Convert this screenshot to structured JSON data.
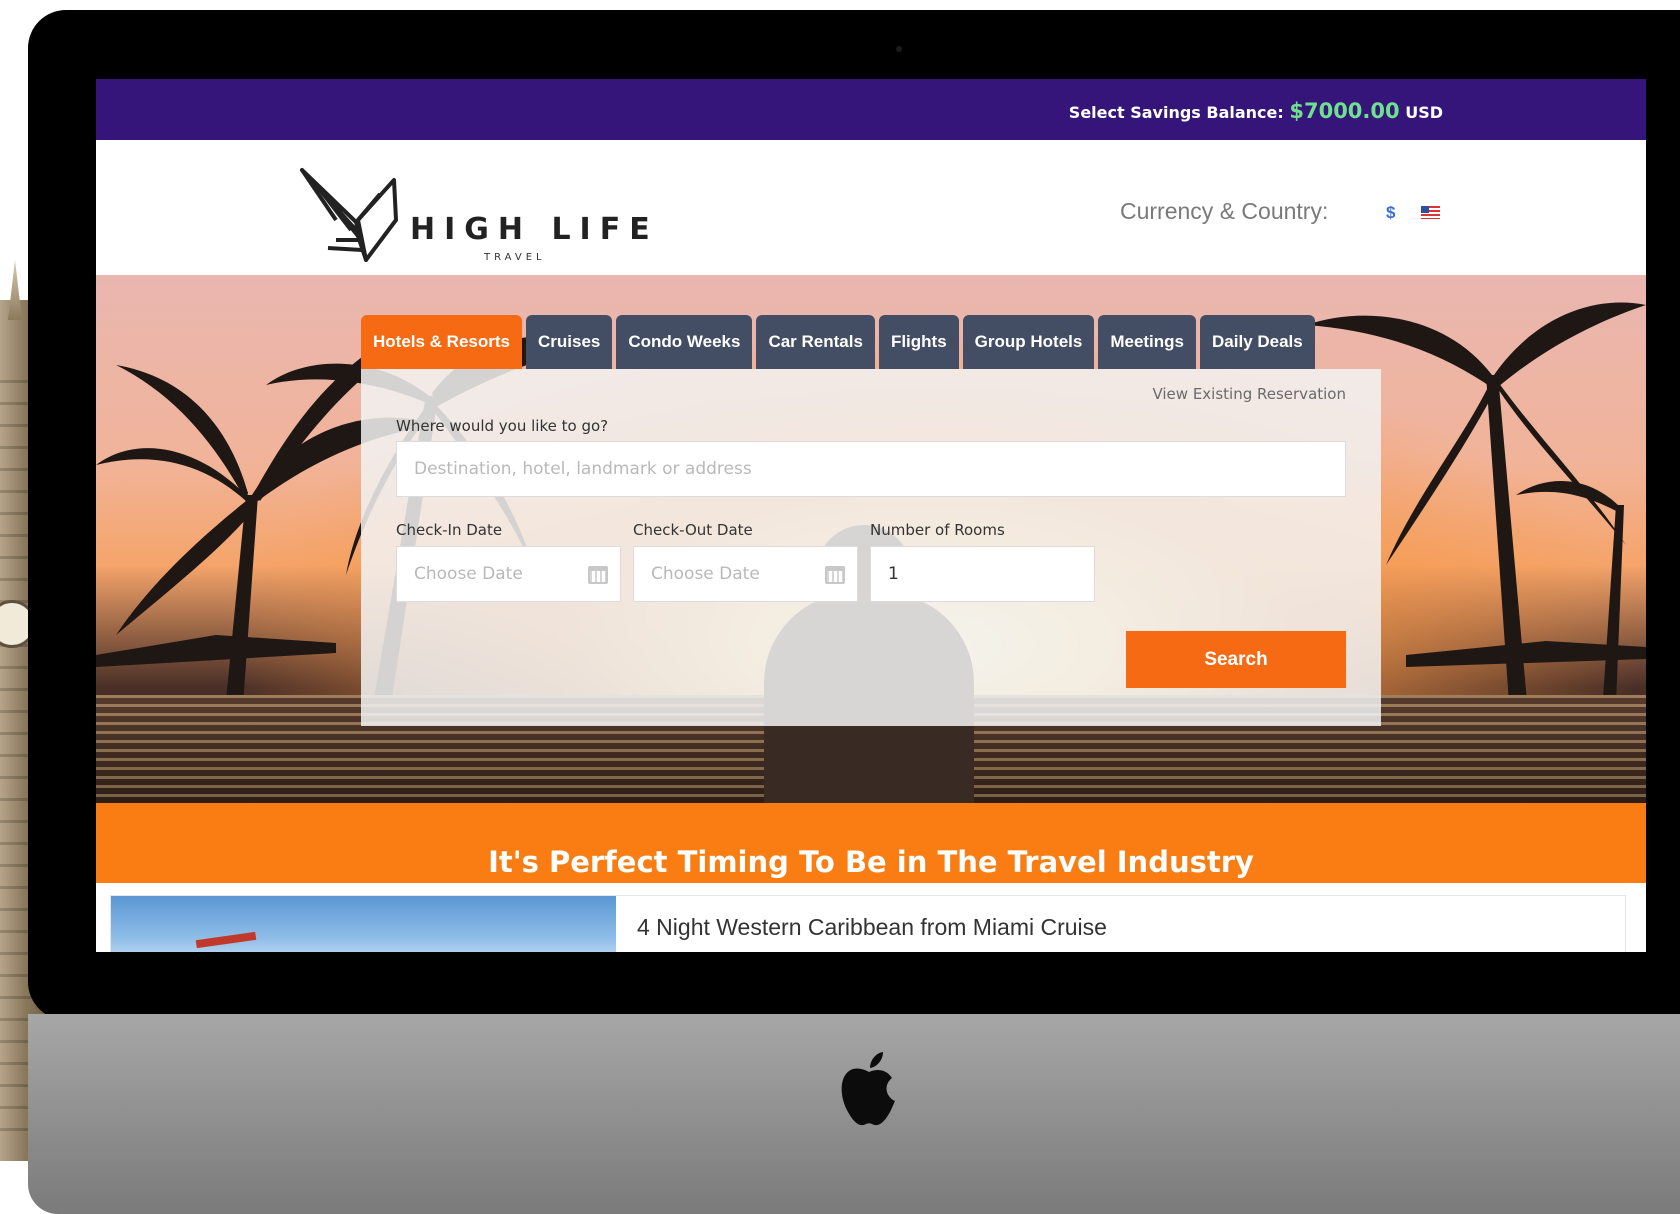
{
  "topbar": {
    "balance_label": "Select Savings Balance:",
    "balance_amount": "$7000.00",
    "balance_currency": "USD"
  },
  "brand": {
    "name": "HIGH LIFE",
    "tagline": "TRAVEL"
  },
  "header": {
    "currency_label": "Currency & Country:",
    "currency_symbol": "$",
    "country_flag": "us-flag-icon"
  },
  "tabs": [
    {
      "label": "Hotels & Resorts",
      "active": true
    },
    {
      "label": "Cruises",
      "active": false
    },
    {
      "label": "Condo Weeks",
      "active": false
    },
    {
      "label": "Car Rentals",
      "active": false
    },
    {
      "label": "Flights",
      "active": false
    },
    {
      "label": "Group Hotels",
      "active": false
    },
    {
      "label": "Meetings",
      "active": false
    },
    {
      "label": "Daily Deals",
      "active": false
    }
  ],
  "search": {
    "view_reservation": "View Existing Reservation",
    "destination_label": "Where would you like to go?",
    "destination_placeholder": "Destination, hotel, landmark or address",
    "checkin_label": "Check-In Date",
    "checkin_placeholder": "Choose Date",
    "checkout_label": "Check-Out Date",
    "checkout_placeholder": "Choose Date",
    "rooms_label": "Number of Rooms",
    "rooms_value": "1",
    "button": "Search"
  },
  "promo": {
    "title": "It's Perfect Timing To Be in The Travel Industry"
  },
  "listing": {
    "title": "4 Night Western Caribbean from Miami Cruise"
  },
  "colors": {
    "topbar": "#36157a",
    "accent_orange": "#f56a12",
    "tab_inactive": "#434d63",
    "balance_green": "#6ee08e"
  }
}
